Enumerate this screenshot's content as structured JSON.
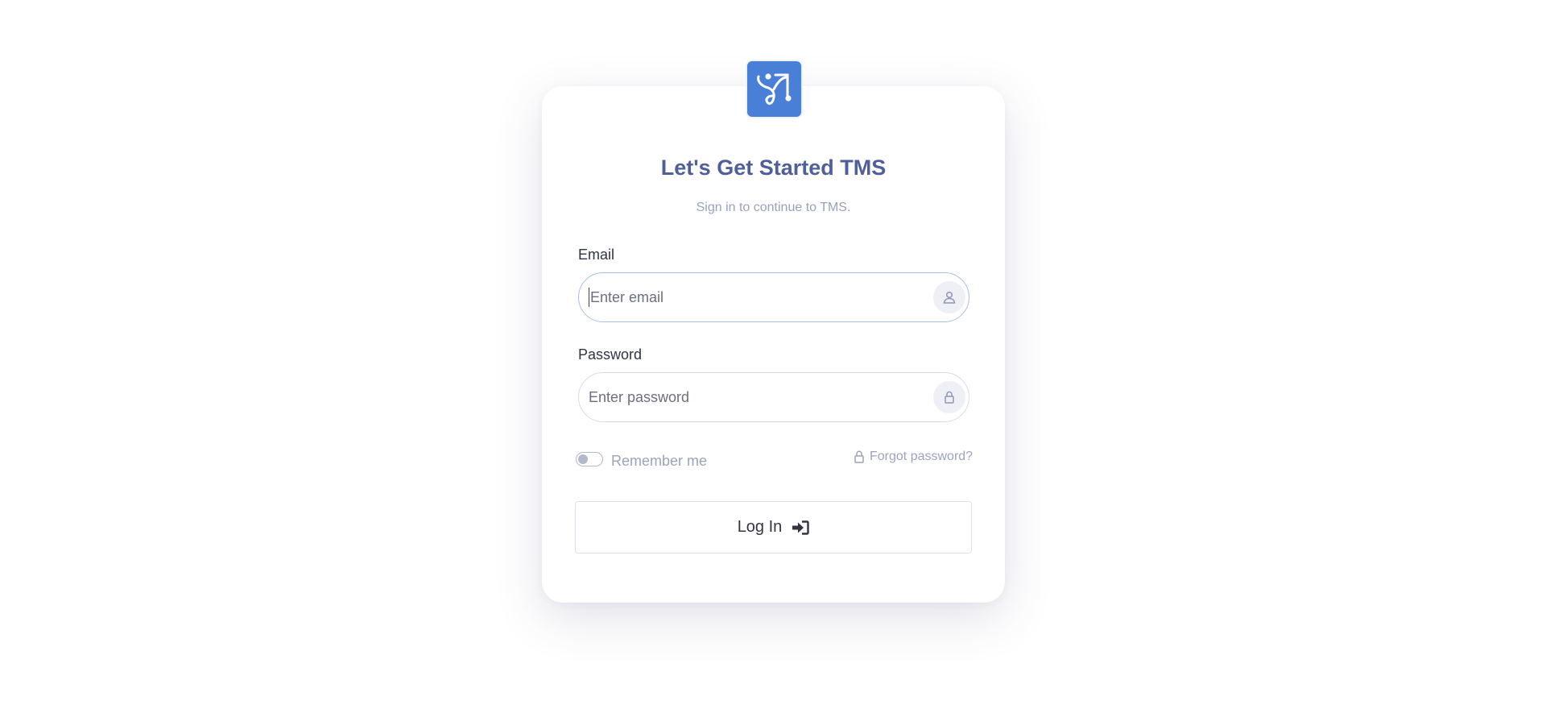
{
  "app": {
    "logo_icon": "app-logo-icon",
    "accent_color": "#4a7fd8"
  },
  "header": {
    "title": "Let's Get Started TMS",
    "subtitle": "Sign in to continue to TMS."
  },
  "form": {
    "email": {
      "label": "Email",
      "placeholder": "Enter email",
      "value": "",
      "icon": "user-icon"
    },
    "password": {
      "label": "Password",
      "placeholder": "Enter password",
      "value": "",
      "icon": "lock-icon"
    },
    "remember_me": {
      "label": "Remember me",
      "checked": false
    },
    "forgot_password": {
      "label": "Forgot password?",
      "icon": "lock-icon"
    },
    "submit": {
      "label": "Log In",
      "icon": "sign-in-icon"
    }
  }
}
